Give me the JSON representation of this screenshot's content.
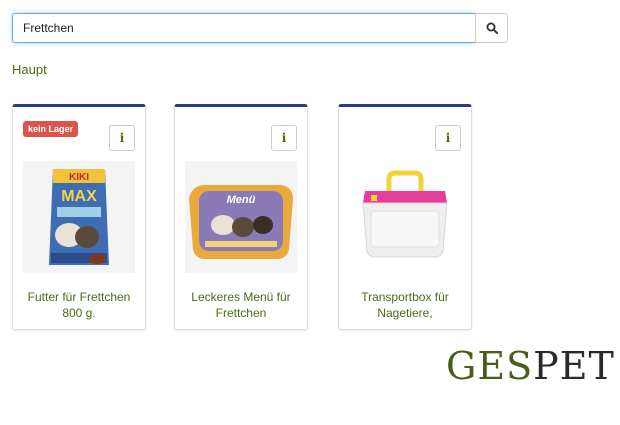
{
  "search": {
    "value": "Frettchen"
  },
  "breadcrumb": {
    "label": "Haupt"
  },
  "products": [
    {
      "title": "Futter für Frettchen 800 g.",
      "badge": "kein Lager",
      "info_icon": "i"
    },
    {
      "title": "Leckeres Menü für Frettchen",
      "info_icon": "i"
    },
    {
      "title": "Transportbox für Nagetiere,",
      "info_icon": "i"
    }
  ],
  "package_labels": {
    "brand": "KIKI",
    "line": "MAX",
    "tray": "Menü"
  },
  "logo": {
    "part1": "GES",
    "part2": "PET"
  },
  "colors": {
    "accent_green": "#4b6b14",
    "card_top_border": "#2b3a8f",
    "badge_red": "#d9534f"
  }
}
